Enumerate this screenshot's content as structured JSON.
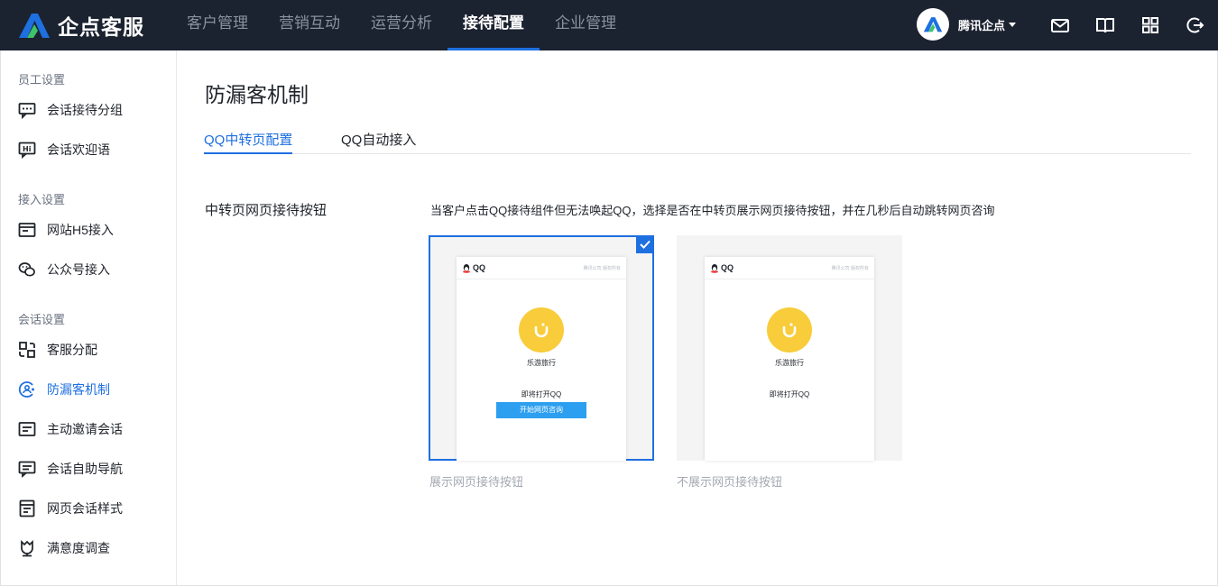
{
  "app": {
    "name": "企点客服"
  },
  "nav": [
    {
      "label": "客户管理",
      "active": false
    },
    {
      "label": "营销互动",
      "active": false
    },
    {
      "label": "运营分析",
      "active": false
    },
    {
      "label": "接待配置",
      "active": true
    },
    {
      "label": "企业管理",
      "active": false
    }
  ],
  "user": {
    "name": "腾讯企点"
  },
  "top_icons": [
    "mail-icon",
    "book-icon",
    "grid-apps-icon",
    "logout-icon"
  ],
  "sidebar": {
    "groups": [
      {
        "title": "员工设置",
        "items": [
          {
            "label": "会话接待分组",
            "icon": "chat-group-icon"
          },
          {
            "label": "会话欢迎语",
            "icon": "hi-greeting-icon"
          }
        ]
      },
      {
        "title": "接入设置",
        "items": [
          {
            "label": "网站H5接入",
            "icon": "web-window-icon"
          },
          {
            "label": "公众号接入",
            "icon": "wechat-icon"
          }
        ]
      },
      {
        "title": "会话设置",
        "items": [
          {
            "label": "客服分配",
            "icon": "distribute-icon"
          },
          {
            "label": "防漏客机制",
            "icon": "anti-leak-icon",
            "active": true
          },
          {
            "label": "主动邀请会话",
            "icon": "invite-icon"
          },
          {
            "label": "会话自助导航",
            "icon": "self-nav-icon"
          },
          {
            "label": "网页会话样式",
            "icon": "web-style-icon"
          },
          {
            "label": "满意度调查",
            "icon": "survey-icon"
          }
        ]
      }
    ]
  },
  "main": {
    "title": "防漏客机制",
    "tabs": [
      {
        "label": "QQ中转页配置",
        "active": true
      },
      {
        "label": "QQ自动接入",
        "active": false
      }
    ],
    "row_label": "中转页网页接待按钮",
    "description": "当客户点击QQ接待组件但无法唤起QQ，选择是否在中转页展示网页接待按钮，并在几秒后自动跳转网页咨询",
    "options": [
      {
        "caption": "展示网页接待按钮",
        "selected": true,
        "preview": {
          "logo_text": "QQ",
          "header_right": "腾讯公司 版权所有",
          "brand": "乐游旅行",
          "opening": "即将打开QQ",
          "button": "开始网页咨询"
        }
      },
      {
        "caption": "不展示网页接待按钮",
        "selected": false,
        "preview": {
          "logo_text": "QQ",
          "header_right": "腾讯公司 版权所有",
          "brand": "乐游旅行",
          "opening": "即将打开QQ"
        }
      }
    ]
  },
  "colors": {
    "topbar": "#1b2230",
    "accent": "#1e6fe0",
    "brand_yellow": "#f8cc3a",
    "button_blue": "#2d9ff0"
  }
}
